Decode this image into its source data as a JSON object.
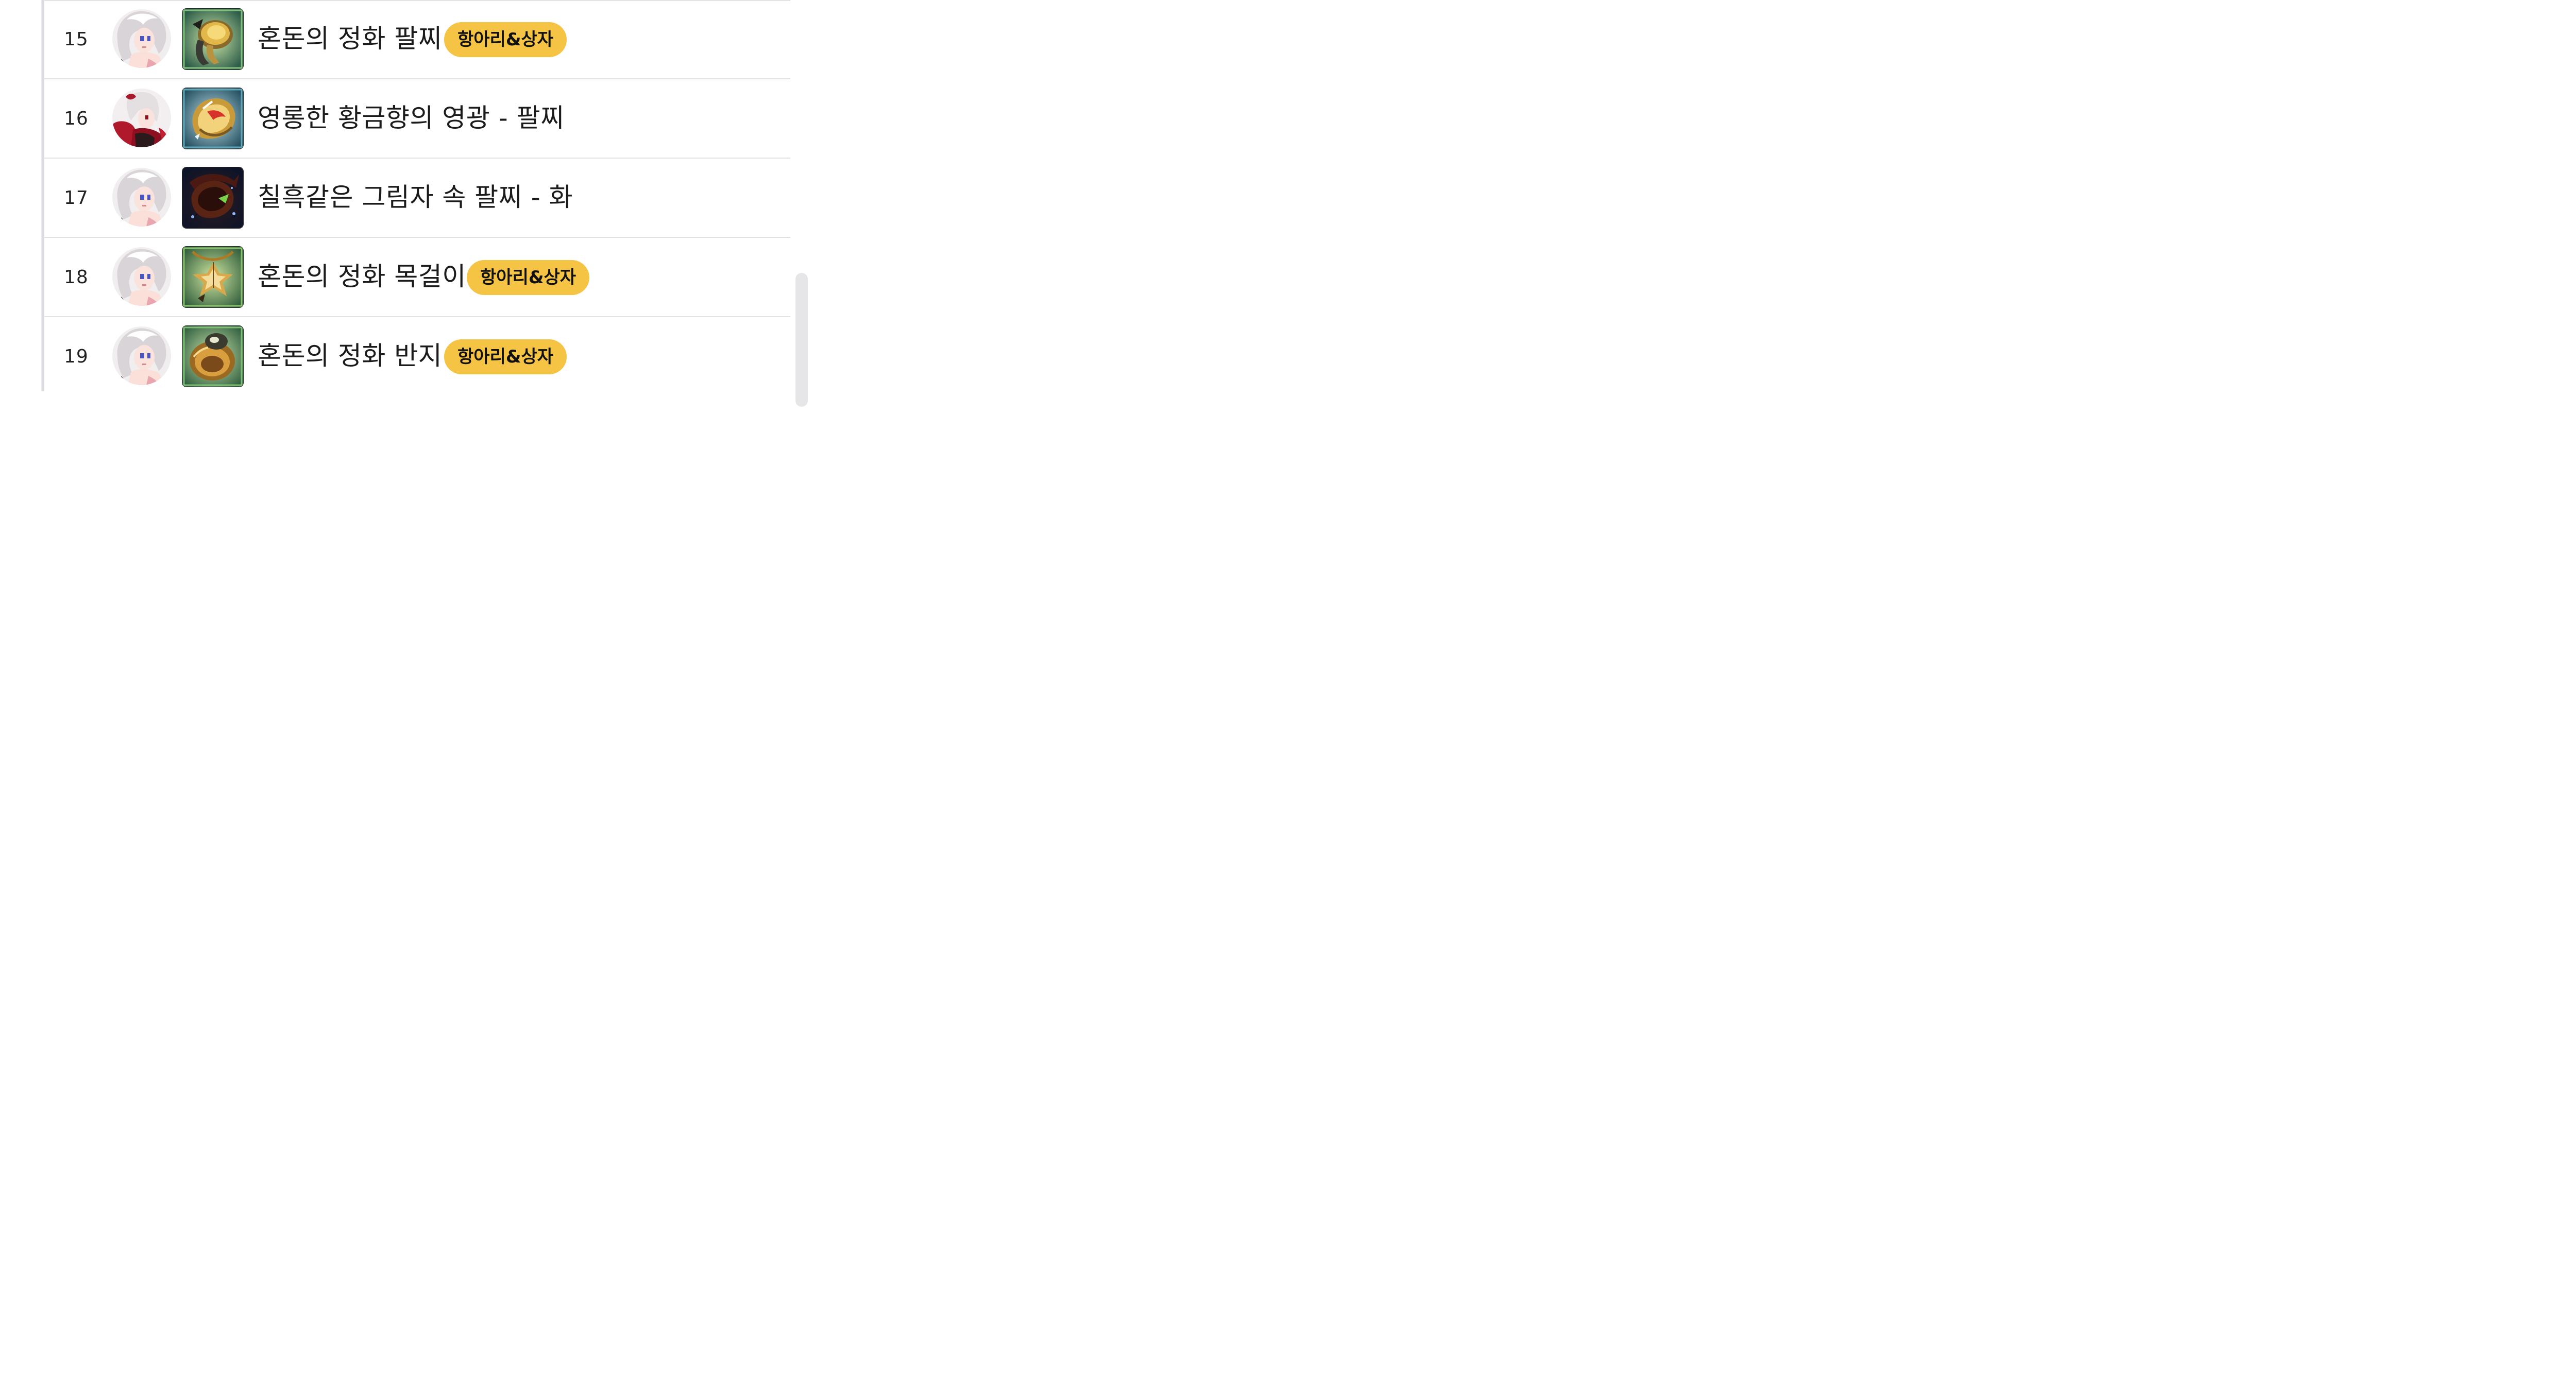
{
  "rows": [
    {
      "rank": "15",
      "avatar": "silver-hair-character-avatar",
      "item_icon": "golden-bracelet-icon",
      "name": "혼돈의 정화 팔찌",
      "badge": "항아리&상자"
    },
    {
      "rank": "16",
      "avatar": "red-dress-character-avatar",
      "item_icon": "gold-fire-bracelet-icon",
      "name": "영롱한 황금향의 영광 - 팔찌",
      "badge": ""
    },
    {
      "rank": "17",
      "avatar": "silver-hair-character-avatar",
      "item_icon": "dark-shadow-bracelet-icon",
      "name": "칠흑같은 그림자 속 팔찌 - 화",
      "badge": ""
    },
    {
      "rank": "18",
      "avatar": "silver-hair-character-avatar",
      "item_icon": "golden-star-necklace-icon",
      "name": "혼돈의 정화 목걸이",
      "badge": "항아리&상자"
    },
    {
      "rank": "19",
      "avatar": "silver-hair-character-avatar",
      "item_icon": "golden-ring-icon",
      "name": "혼돈의 정화 반지",
      "badge": "항아리&상자"
    }
  ],
  "colors": {
    "badge_background": "#f6c444",
    "divider": "#e1e1e6",
    "text": "#1b1b1b"
  }
}
